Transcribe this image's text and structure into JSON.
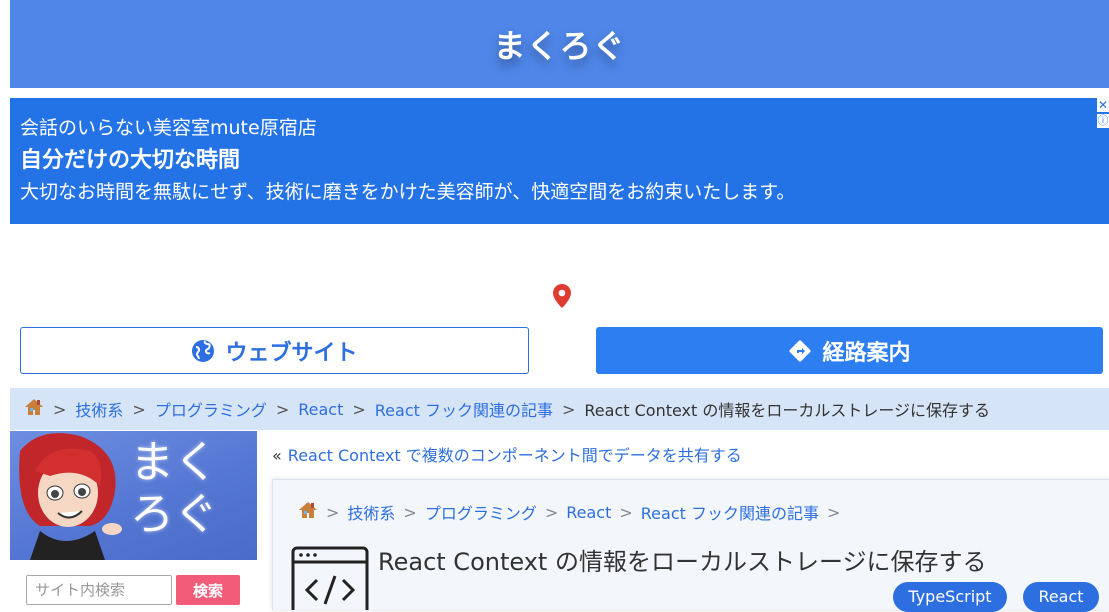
{
  "header": {
    "site_title": "まくろぐ"
  },
  "ad": {
    "line1": "会話のいらない美容室mute原宿店",
    "line2": "自分だけの大切な時間",
    "line3": "大切なお時間を無駄にせず、技術に磨きをかけた美容師が、快適空間をお約束いたします。",
    "close_glyph": "✕",
    "info_glyph": "ⓘ",
    "website_button": "ウェブサイト",
    "route_button": "経路案内",
    "accent": "#2473e6"
  },
  "breadcrumb": {
    "home_icon": "house-icon",
    "items": [
      "技術系",
      "プログラミング",
      "React",
      "React フック関連の記事"
    ],
    "current": "React Context の情報をローカルストレージに保存する",
    "sep": ">"
  },
  "sidebar": {
    "banner_text": "まく\nろぐ",
    "search_placeholder": "サイト内検索",
    "search_button": "検索"
  },
  "main": {
    "prev_quote": "«",
    "prev_link": "React Context で複数のコンポーネント間でデータを共有する",
    "inner_breadcrumb": [
      "技術系",
      "プログラミング",
      "React",
      "React フック関連の記事"
    ],
    "title": "React Context の情報をローカルストレージに保存する",
    "tags": [
      "TypeScript",
      "React"
    ]
  },
  "colors": {
    "header_bg": "#4f86e8",
    "link": "#2d6fe0",
    "search_button": "#f25c78",
    "breadcrumb_bg": "#d6e4f7"
  }
}
